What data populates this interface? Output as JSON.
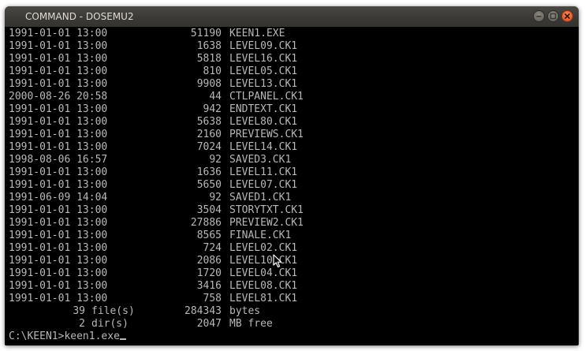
{
  "window": {
    "title": "COMMAND - DOSEMU2"
  },
  "listing": [
    {
      "datetime": "1991-01-01 13:00",
      "size": "51190",
      "name": "KEEN1.EXE"
    },
    {
      "datetime": "1991-01-01 13:00",
      "size": "1638",
      "name": "LEVEL09.CK1"
    },
    {
      "datetime": "1991-01-01 13:00",
      "size": "5818",
      "name": "LEVEL16.CK1"
    },
    {
      "datetime": "1991-01-01 13:00",
      "size": "810",
      "name": "LEVEL05.CK1"
    },
    {
      "datetime": "1991-01-01 13:00",
      "size": "9908",
      "name": "LEVEL13.CK1"
    },
    {
      "datetime": "2000-08-26 20:58",
      "size": "44",
      "name": "CTLPANEL.CK1"
    },
    {
      "datetime": "1991-01-01 13:00",
      "size": "942",
      "name": "ENDTEXT.CK1"
    },
    {
      "datetime": "1991-01-01 13:00",
      "size": "5638",
      "name": "LEVEL80.CK1"
    },
    {
      "datetime": "1991-01-01 13:00",
      "size": "2160",
      "name": "PREVIEWS.CK1"
    },
    {
      "datetime": "1991-01-01 13:00",
      "size": "7024",
      "name": "LEVEL14.CK1"
    },
    {
      "datetime": "1998-08-06 16:57",
      "size": "92",
      "name": "SAVED3.CK1"
    },
    {
      "datetime": "1991-01-01 13:00",
      "size": "1636",
      "name": "LEVEL11.CK1"
    },
    {
      "datetime": "1991-01-01 13:00",
      "size": "5650",
      "name": "LEVEL07.CK1"
    },
    {
      "datetime": "1991-06-09 14:04",
      "size": "92",
      "name": "SAVED1.CK1"
    },
    {
      "datetime": "1991-01-01 13:00",
      "size": "3504",
      "name": "STORYTXT.CK1"
    },
    {
      "datetime": "1991-01-01 13:00",
      "size": "27886",
      "name": "PREVIEW2.CK1"
    },
    {
      "datetime": "1991-01-01 13:00",
      "size": "8565",
      "name": "FINALE.CK1"
    },
    {
      "datetime": "1991-01-01 13:00",
      "size": "724",
      "name": "LEVEL02.CK1"
    },
    {
      "datetime": "1991-01-01 13:00",
      "size": "2086",
      "name": "LEVEL10.CK1"
    },
    {
      "datetime": "1991-01-01 13:00",
      "size": "1720",
      "name": "LEVEL04.CK1"
    },
    {
      "datetime": "1991-01-01 13:00",
      "size": "3416",
      "name": "LEVEL08.CK1"
    },
    {
      "datetime": "1991-01-01 13:00",
      "size": "758",
      "name": "LEVEL81.CK1"
    }
  ],
  "summary": {
    "files_count": "39",
    "files_label": "file(s)",
    "files_size": "284343",
    "files_unit": "bytes",
    "dirs_count": "2",
    "dirs_label": "dir(s)",
    "dirs_free": "2047",
    "dirs_unit": "MB free"
  },
  "prompt": {
    "path": "C:\\KEEN1>",
    "command": "keen1.exe"
  },
  "icons": {
    "minimize": "minimize-icon",
    "maximize": "maximize-icon",
    "close": "close-icon",
    "pointer": "mouse-pointer-icon"
  },
  "colors": {
    "terminal_bg": "#000000",
    "terminal_fg": "#b8b8b8",
    "titlebar": "#3c3b37",
    "close_button": "#e05a2a"
  }
}
